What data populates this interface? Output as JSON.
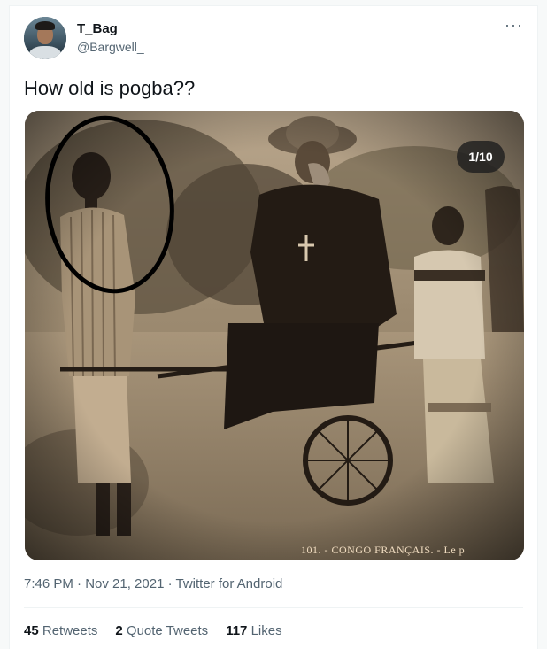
{
  "author": {
    "name": "T_Bag",
    "handle": "@Bargwell_"
  },
  "tweet": {
    "text": "How old is pogba??",
    "media_counter": "1/10",
    "photo_caption": "101. - CONGO FRANÇAIS. - Le p",
    "timestamp": "7:46 PM · Nov 21, 2021 · Twitter for Android"
  },
  "stats": {
    "retweets_count": "45",
    "retweets_label": "Retweets",
    "quotes_count": "2",
    "quotes_label": "Quote Tweets",
    "likes_count": "117",
    "likes_label": "Likes"
  },
  "icons": {
    "more": "more-options-icon"
  },
  "colors": {
    "primary_text": "#0f1419",
    "secondary_text": "#536471",
    "border": "#eff3f4",
    "annotation_circle": "#000000"
  }
}
